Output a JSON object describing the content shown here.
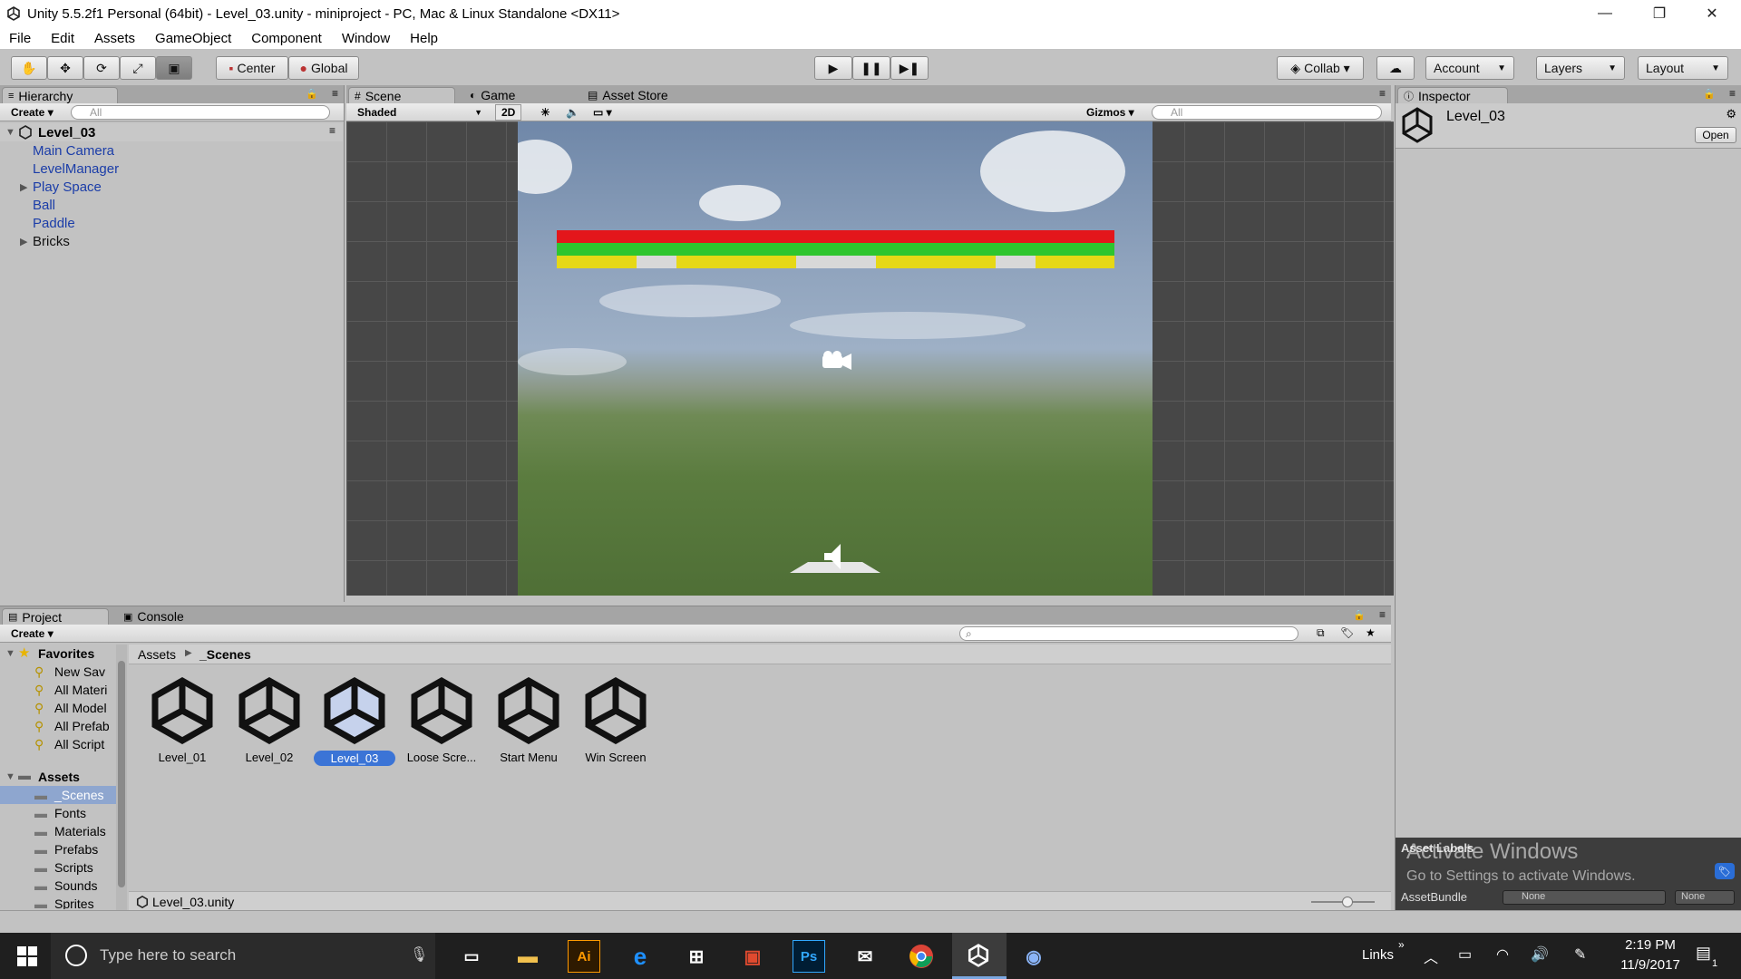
{
  "window": {
    "title": "Unity 5.5.2f1 Personal (64bit) - Level_03.unity - miniproject - PC, Mac & Linux Standalone <DX11>",
    "controls": {
      "minimize": "—",
      "restore": "❐",
      "close": "✕"
    }
  },
  "menu": [
    "File",
    "Edit",
    "Assets",
    "GameObject",
    "Component",
    "Window",
    "Help"
  ],
  "toolbar": {
    "pivot": "Center",
    "space": "Global",
    "collab": "Collab ▾",
    "account": "Account",
    "layers": "Layers",
    "layout": "Layout"
  },
  "hierarchy": {
    "tab": "Hierarchy",
    "create": "Create ▾",
    "search_placeholder": "All",
    "scene": "Level_03",
    "items": [
      "Main Camera",
      "LevelManager",
      "Play Space",
      "Ball",
      "Paddle",
      "Bricks"
    ]
  },
  "scene": {
    "tabs": [
      "Scene",
      "Game",
      "Asset Store"
    ],
    "shading": "Shaded",
    "mode_2d": "2D",
    "gizmos": "Gizmos ▾",
    "search_placeholder": "All"
  },
  "inspector": {
    "tab": "Inspector",
    "object": "Level_03",
    "open": "Open",
    "asset_labels": "Asset Labels",
    "asset_bundle": "AssetBundle",
    "bundle_value": "None",
    "variant_value": "None",
    "watermark_title": "Activate Windows",
    "watermark_text": "Go to Settings to activate Windows."
  },
  "project": {
    "tabs": [
      "Project",
      "Console"
    ],
    "create": "Create ▾",
    "favorites_header": "Favorites",
    "favorites": [
      "New Sav",
      "All Materi",
      "All Model",
      "All Prefab",
      "All Script"
    ],
    "assets_header": "Assets",
    "folders": [
      "_Scenes",
      "Fonts",
      "Materials",
      "Prefabs",
      "Scripts",
      "Sounds",
      "Sprites"
    ],
    "breadcrumb_root": "Assets",
    "breadcrumb_current": "_Scenes",
    "assets": [
      "Level_01",
      "Level_02",
      "Level_03",
      "Loose Scre...",
      "Start Menu",
      "Win Screen"
    ],
    "selected_asset": "Level_03",
    "footer_path": "Level_03.unity"
  },
  "taskbar": {
    "search_placeholder": "Type here to search",
    "links": "Links",
    "time": "2:19 PM",
    "date": "11/9/2017",
    "notifications": "1"
  }
}
